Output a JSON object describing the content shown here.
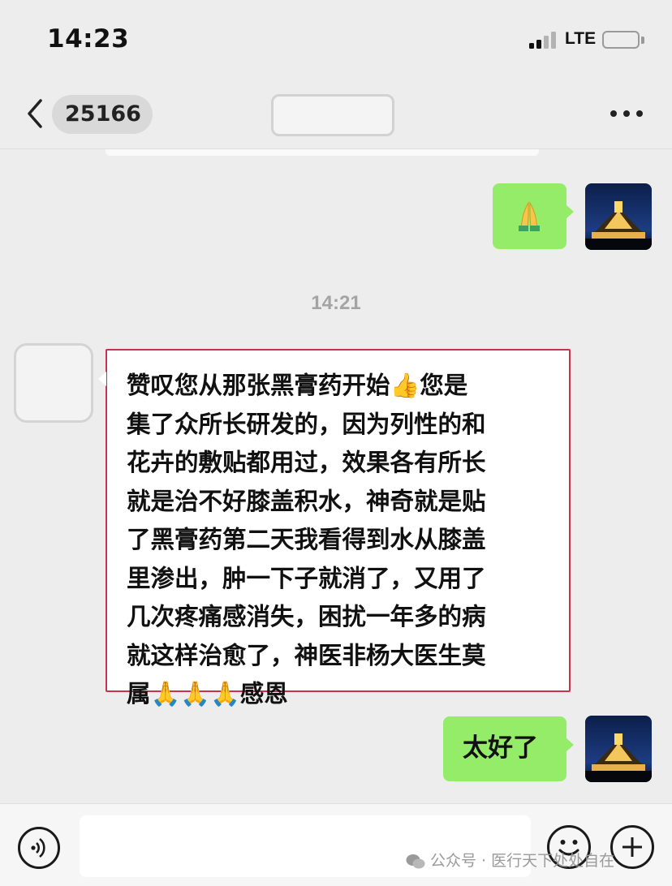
{
  "status_bar": {
    "time": "14:23",
    "network": "LTE"
  },
  "nav": {
    "unread_count": "25166"
  },
  "messages": {
    "time_divider": "14:21",
    "received_lines": [
      "赞叹您从那张黑膏药开始👍您是",
      "集了众所长研发的，因为列性的和",
      "花卉的敷贴都用过，效果各有所长",
      "就是治不好膝盖积水，神奇就是贴",
      "了黑膏药第二天我看得到水从膝盖",
      "里渗出，肿一下子就消了，又用了",
      "几次疼痛感消失，困扰一年多的病",
      "就这样治愈了，神医非杨大医生莫",
      "属🙏🙏🙏感恩"
    ],
    "sent_reply": "太好了"
  },
  "watermark": "公众号 · 医行天下处处自在",
  "colors": {
    "bubble_sent": "#95ec69",
    "highlight_border": "#c8324f",
    "background": "#ededed"
  },
  "icons": {
    "sent_emoji": "folded-hands",
    "back": "chevron-left",
    "more": "ellipsis",
    "voice": "voice",
    "emoji": "smiley",
    "plus": "plus"
  }
}
